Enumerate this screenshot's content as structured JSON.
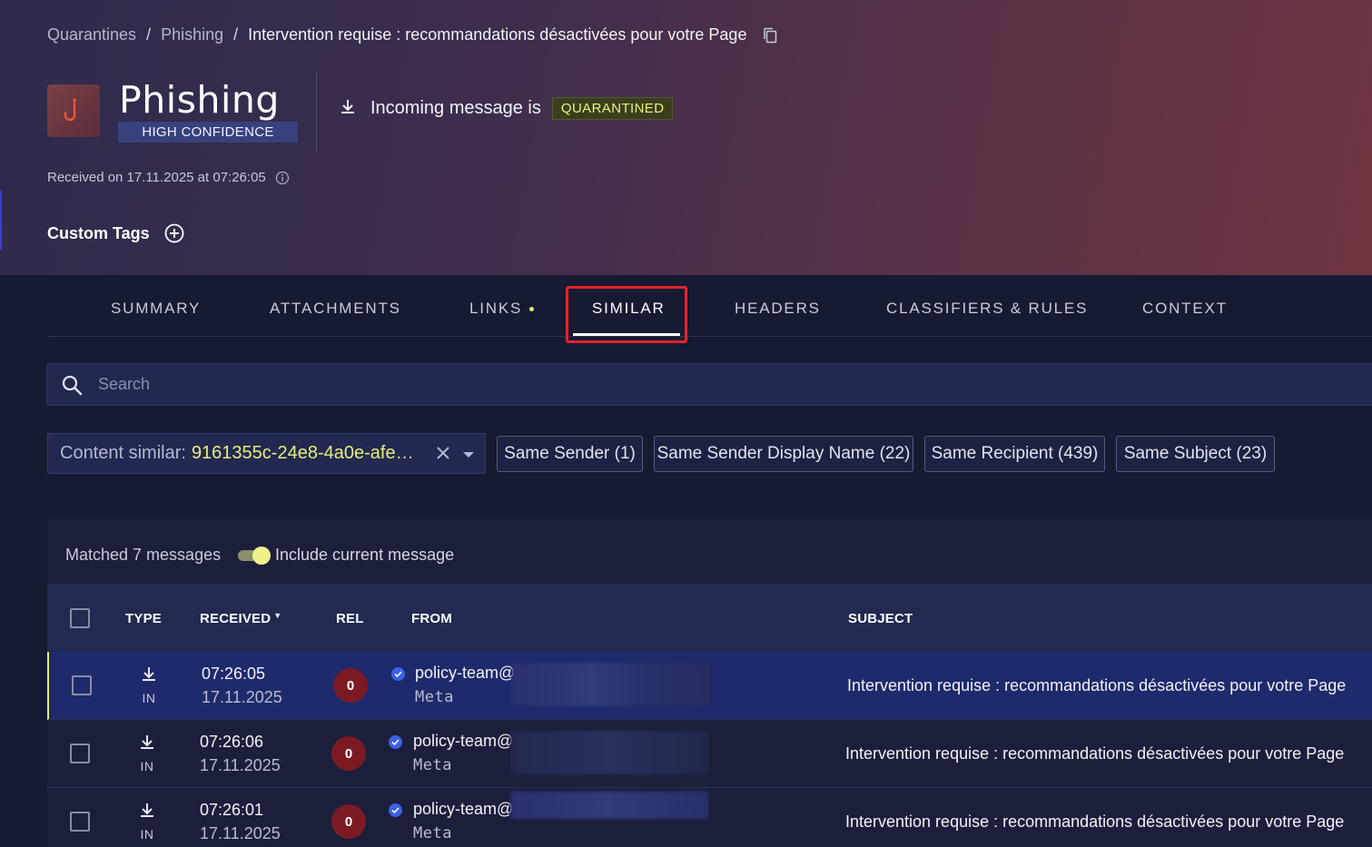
{
  "breadcrumb": {
    "items": [
      "Quarantines",
      "Phishing"
    ],
    "separator": "/",
    "current": "Intervention requise : recommandations désactivées pour votre Page"
  },
  "threat": {
    "title": "Phishing",
    "confidence": "HIGH CONFIDENCE",
    "icon": "fishhook-icon"
  },
  "status": {
    "direction_text": "Incoming message is",
    "badge": "QUARANTINED"
  },
  "received_text": "Received on 17.11.2025 at 07:26:05",
  "custom_tags": {
    "label": "Custom Tags"
  },
  "tabs": [
    {
      "label": "SUMMARY"
    },
    {
      "label": "ATTACHMENTS"
    },
    {
      "label": "LINKS",
      "has_dot": true
    },
    {
      "label": "SIMILAR",
      "active": true
    },
    {
      "label": "HEADERS"
    },
    {
      "label": "CLASSIFIERS & RULES"
    },
    {
      "label": "CONTEXT"
    }
  ],
  "search": {
    "placeholder": "Search",
    "value": ""
  },
  "filters": {
    "content_similar_label": "Content similar:",
    "content_similar_value": "9161355c-24e8-4a0e-afe…",
    "chips": [
      "Same Sender (1)",
      "Same Sender Display Name (22)",
      "Same Recipient (439)",
      "Same Subject (23)"
    ]
  },
  "results": {
    "matched_text": "Matched 7 messages",
    "include_current_label": "Include current message",
    "include_current": true
  },
  "table": {
    "columns": {
      "type": "TYPE",
      "received": "RECEIVED",
      "rel": "REL",
      "from": "FROM",
      "subject": "SUBJECT"
    },
    "rows": [
      {
        "type": "IN",
        "time": "07:26:05",
        "date": "17.11.2025",
        "rel": "0",
        "from_email": "policy-team@",
        "from_name": "Meta",
        "subject": "Intervention requise : recommandations désactivées pour votre Page",
        "selected": true
      },
      {
        "type": "IN",
        "time": "07:26:06",
        "date": "17.11.2025",
        "rel": "0",
        "from_email": "policy-team@",
        "from_name": "Meta",
        "subject": "Intervention requise : recommandations désactivées pour votre Page",
        "selected": false
      },
      {
        "type": "IN",
        "time": "07:26:01",
        "date": "17.11.2025",
        "rel": "0",
        "from_email": "policy-team@",
        "from_name": "Meta",
        "subject": "Intervention requise : recommandations désactivées pour votre Page",
        "selected": false
      }
    ]
  },
  "colors": {
    "accent_yellow": "#e6ef7a",
    "highlight_red": "#e8232b",
    "rel_badge": "#7c1a24",
    "confidence_bg": "#37417e"
  }
}
